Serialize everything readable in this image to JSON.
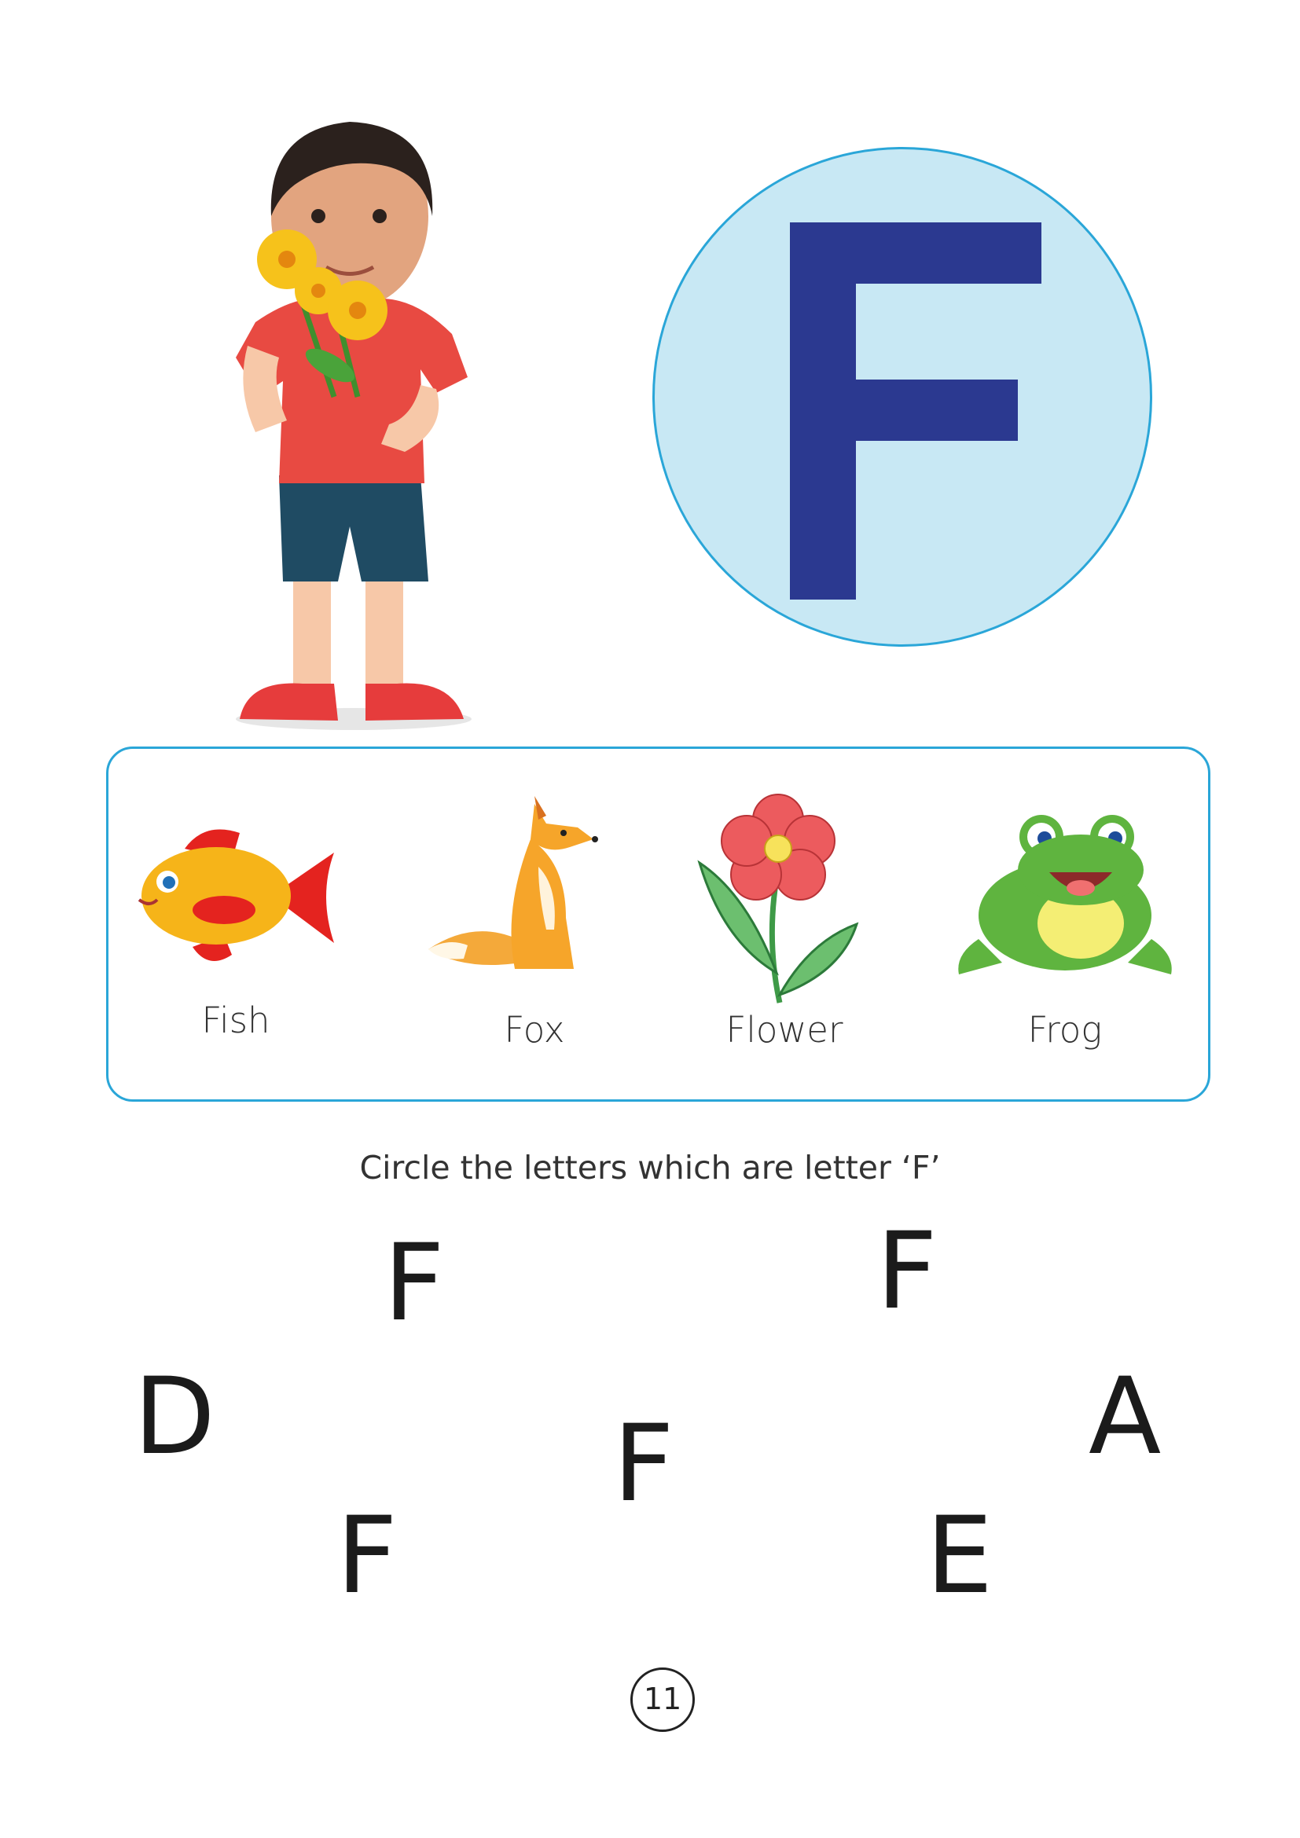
{
  "hero": {
    "letter": "F"
  },
  "words": [
    {
      "label": "Fish",
      "icon": "fish-icon"
    },
    {
      "label": "Fox",
      "icon": "fox-icon"
    },
    {
      "label": "Flower",
      "icon": "flower-icon"
    },
    {
      "label": "Frog",
      "icon": "frog-icon"
    }
  ],
  "activity": {
    "instruction": "Circle the letters which are letter ‘F’",
    "letters": [
      "F",
      "F",
      "D",
      "F",
      "A",
      "F",
      "E"
    ]
  },
  "page_number": "11",
  "colors": {
    "accent_blue": "#2aa6d8",
    "letter_navy": "#2b3990",
    "circle_fill": "#c8e8f4"
  }
}
